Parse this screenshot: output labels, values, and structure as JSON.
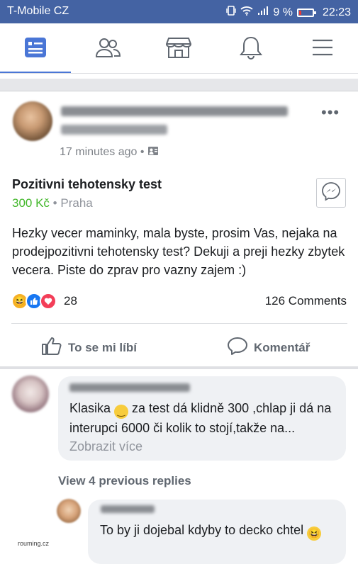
{
  "status_bar": {
    "carrier": "T-Mobile CZ",
    "battery": "9 %",
    "time": "22:23"
  },
  "navbar": {
    "icons": [
      "news-feed-icon",
      "friends-icon",
      "marketplace-icon",
      "notifications-icon",
      "menu-icon"
    ]
  },
  "post": {
    "time": "17 minutes ago",
    "privacy_icon": "groups-icon",
    "title": "Pozitivni tehotensky test",
    "price": "300 Kč",
    "price_separator": "•",
    "location": "Praha",
    "body": "Hezky vecer maminky, mala byste, prosim Vas, nejaka na prodejpozitivni  tehotensky test? Dekuji a preji hezky zbytek vecera. Piste do zprav pro vazny zajem :)",
    "reactions": {
      "types": [
        "haha",
        "like",
        "love"
      ],
      "count": "28"
    },
    "comments_count": "126 Comments",
    "actions": {
      "like_label": "To se mi líbí",
      "comment_label": "Komentář"
    }
  },
  "comments": [
    {
      "text_before_emoji": "Klasika ",
      "emoji": "slightly-smiling-face",
      "text_after_emoji": " za test dá klidně 300 ,chlap ji dá na interupci 6000 či kolik to stojí,takže na...",
      "see_more": "Zobrazit více"
    }
  ],
  "view_previous": "View 4 previous replies",
  "reply": {
    "text": "To by ji dojebal kdyby to decko chtel",
    "emoji": "laughing-face"
  },
  "watermark": "rouming.cz",
  "colors": {
    "status_bar": "#4463a3",
    "accent_blue": "#4a76d6",
    "price_green": "#42b72a",
    "haha": "#f7b125",
    "like": "#1877f2",
    "love": "#f33e58"
  }
}
